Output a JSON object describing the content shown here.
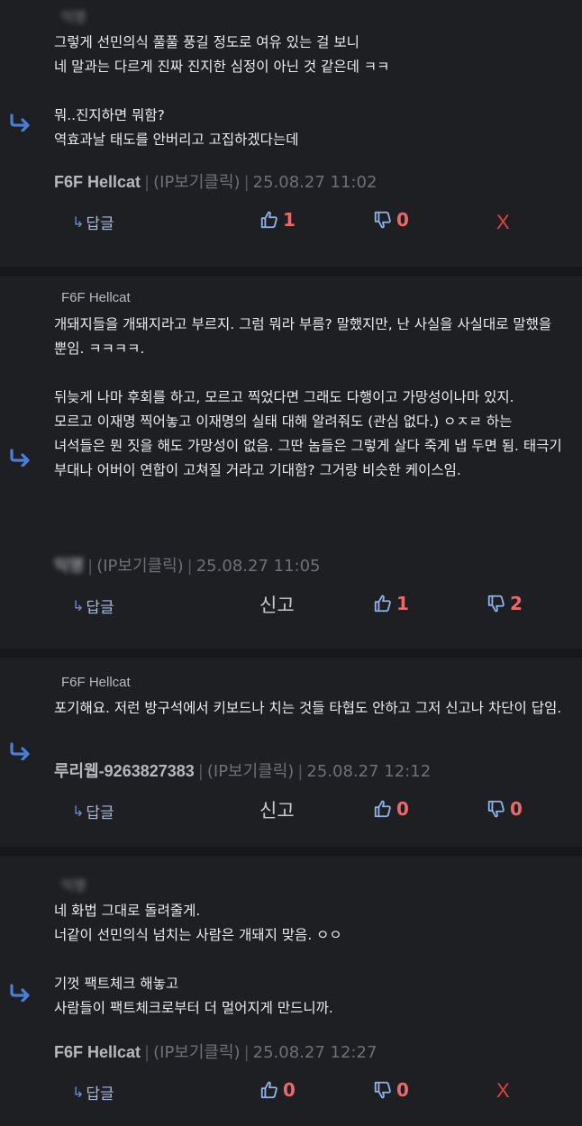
{
  "comments": [
    {
      "quoted_author": "익명",
      "body": "그렇게 선민의식 풀풀 풍길 정도로 여유 있는 걸 보니\n네 말과는 다르게 진짜 진지한 심정이 아닌 것 같은데 ㅋㅋ\n\n뭐..진지하면 뭐함?\n역효과날 태도를 안버리고 고집하겠다는데",
      "author": "F6F Hellcat",
      "ip_label": "(IP보기클릭)",
      "date": "25.08.27 11:02",
      "reply_label": "답글",
      "upvotes": "1",
      "downvotes": "0",
      "delete_label": "X"
    },
    {
      "quoted_author": "F6F Hellcat",
      "body": "개돼지들을 개돼지라고 부르지. 그럼 뭐라 부름? 말했지만, 난 사실을 사실대로 말했을 뿐임. ㅋㅋㅋㅋ.\n\n뒤늦게 나마 후회를 하고, 모르고 찍었다면 그래도 다행이고 가망성이나마 있지.\n모르고 이재명 찍어놓고 이재명의 실태 대해 알려줘도 (관심 없다.) ㅇㅈㄹ 하는 녀석들은 뭔 짓을 해도 가망성이 없음. 그딴 놈들은 그렇게 살다 죽게 냅 두면 됨. 태극기 부대나 어버이 연합이 고쳐질 거라고 기대함? 그거랑 비슷한 케이스임.",
      "author": "익명",
      "ip_label": "(IP보기클릭)",
      "date": "25.08.27 11:05",
      "reply_label": "답글",
      "report_label": "신고",
      "upvotes": "1",
      "downvotes": "2"
    },
    {
      "quoted_author": "F6F Hellcat",
      "body": "포기해요. 저런 방구석에서 키보드나 치는 것들 타협도 안하고 그저 신고나 차단이 답임.",
      "author": "루리웹-9263827383",
      "ip_label": "(IP보기클릭)",
      "date": "25.08.27 12:12",
      "reply_label": "답글",
      "report_label": "신고",
      "upvotes": "0",
      "downvotes": "0"
    },
    {
      "quoted_author": "익명",
      "body": "네 화법 그대로 돌려줄게.\n너같이 선민의식 넘치는 사람은 개돼지 맞음. ㅇㅇ\n\n기껏 팩트체크 해놓고\n사람들이 팩트체크로부터 더 멀어지게 만드니까.",
      "author": "F6F Hellcat",
      "ip_label": "(IP보기클릭)",
      "date": "25.08.27 12:27",
      "reply_label": "답글",
      "upvotes": "0",
      "downvotes": "0",
      "delete_label": "X"
    }
  ],
  "colors": {
    "background": "#1e1f23",
    "divider": "#17181b",
    "upvote_icon": "#8fb3e8",
    "downvote_icon": "#8fb3e8",
    "count": "#e86a6a",
    "delete": "#e0443c",
    "reply_arrow": "#4a7fd6"
  },
  "icons": {
    "reply_arrow": "reply-arrow-icon",
    "thumbs_up": "thumbs-up-icon",
    "thumbs_down": "thumbs-down-icon"
  }
}
